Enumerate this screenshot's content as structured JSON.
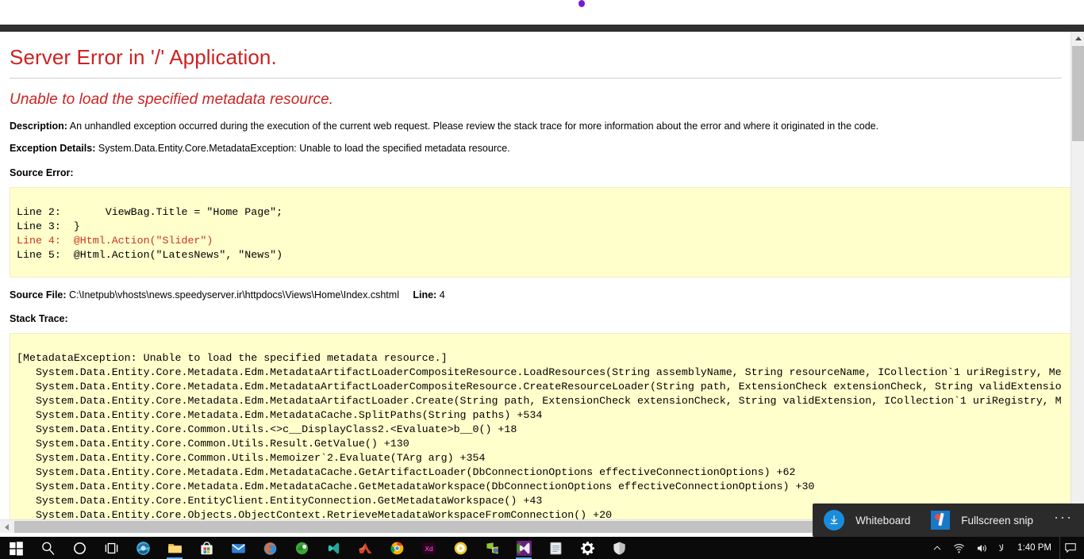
{
  "error_page": {
    "title": "Server Error in '/' Application.",
    "subtitle": "Unable to load the specified metadata resource.",
    "description_label": "Description:",
    "description_text": "An unhandled exception occurred during the execution of the current web request. Please review the stack trace for more information about the error and where it originated in the code.",
    "exception_label": "Exception Details:",
    "exception_text": "System.Data.Entity.Core.MetadataException: Unable to load the specified metadata resource.",
    "source_error_label": "Source Error:",
    "source_code_before": "Line 2:       ViewBag.Title = \"Home Page\";\nLine 3:  }\n",
    "source_code_highlight": "Line 4:  @Html.Action(\"Slider\")",
    "source_code_after": "\nLine 5:  @Html.Action(\"LatesNews\", \"News\")",
    "source_file_label": "Source File:",
    "source_file_path": "C:\\Inetpub\\vhosts\\news.speedyserver.ir\\httpdocs\\Views\\Home\\Index.cshtml",
    "line_label": "Line:",
    "line_number": "4",
    "stack_trace_label": "Stack Trace:",
    "stack_trace": "[MetadataException: Unable to load the specified metadata resource.]\n   System.Data.Entity.Core.Metadata.Edm.MetadataArtifactLoaderCompositeResource.LoadResources(String assemblyName, String resourceName, ICollection`1 uriRegistry, Me\n   System.Data.Entity.Core.Metadata.Edm.MetadataArtifactLoaderCompositeResource.CreateResourceLoader(String path, ExtensionCheck extensionCheck, String validExtensio\n   System.Data.Entity.Core.Metadata.Edm.MetadataArtifactLoader.Create(String path, ExtensionCheck extensionCheck, String validExtension, ICollection`1 uriRegistry, M\n   System.Data.Entity.Core.Metadata.Edm.MetadataCache.SplitPaths(String paths) +534\n   System.Data.Entity.Core.Common.Utils.<>c__DisplayClass2.<Evaluate>b__0() +18\n   System.Data.Entity.Core.Common.Utils.Result.GetValue() +130\n   System.Data.Entity.Core.Common.Utils.Memoizer`2.Evaluate(TArg arg) +354\n   System.Data.Entity.Core.Metadata.Edm.MetadataCache.GetArtifactLoader(DbConnectionOptions effectiveConnectionOptions) +62\n   System.Data.Entity.Core.Metadata.Edm.MetadataCache.GetMetadataWorkspace(DbConnectionOptions effectiveConnectionOptions) +30\n   System.Data.Entity.Core.EntityClient.EntityConnection.GetMetadataWorkspace() +43\n   System.Data.Entity.Core.Objects.ObjectContext.RetrieveMetadataWorkspaceFromConnection() +20\n   System.Data.Entity.Core.Objects.ObjectContext..ctor(EntityConnection connection, Boolean isConnectionConstructor, Objec",
    "colors": {
      "title_red": "#cc2222",
      "code_background": "#ffffcc",
      "highlight_red": "#cc3322"
    }
  },
  "snip_toolbar": {
    "whiteboard_label": "Whiteboard",
    "whiteboard_icon": "download-circle-icon",
    "fullscreen_snip_label": "Fullscreen snip",
    "fullscreen_snip_icon": "snip-pen-icon",
    "more_label": "···"
  },
  "taskbar": {
    "items": [
      {
        "icon": "windows-start-icon",
        "name": "start-button"
      },
      {
        "icon": "search-icon",
        "name": "search-button"
      },
      {
        "icon": "cortana-circle-icon",
        "name": "cortana-button"
      },
      {
        "icon": "task-view-icon",
        "name": "task-view-button"
      },
      {
        "icon": "microsoft-edge-icon",
        "name": "taskbar-edge"
      },
      {
        "icon": "file-explorer-icon",
        "name": "taskbar-file-explorer"
      },
      {
        "icon": "microsoft-store-icon",
        "name": "taskbar-store"
      },
      {
        "icon": "mail-icon",
        "name": "taskbar-mail"
      },
      {
        "icon": "firefox-icon",
        "name": "taskbar-firefox"
      },
      {
        "icon": "navicat-icon",
        "name": "taskbar-navicat"
      },
      {
        "icon": "vs-code-icon",
        "name": "taskbar-vscode"
      },
      {
        "icon": "matlab-icon",
        "name": "taskbar-matlab"
      },
      {
        "icon": "google-chrome-icon",
        "name": "taskbar-chrome"
      },
      {
        "icon": "adobe-xd-icon",
        "name": "taskbar-adobe-xd"
      },
      {
        "icon": "media-player-icon",
        "name": "taskbar-media-player"
      },
      {
        "icon": "sql-server-icon",
        "name": "taskbar-sql-server"
      },
      {
        "icon": "visual-studio-icon",
        "name": "taskbar-visual-studio"
      },
      {
        "icon": "notepad-icon",
        "name": "taskbar-notepad"
      },
      {
        "icon": "settings-gear-icon",
        "name": "taskbar-settings"
      },
      {
        "icon": "shield-icon",
        "name": "taskbar-security"
      }
    ],
    "tray": {
      "chevron": "chevron-up-icon",
      "network": "wifi-icon",
      "volume": "speaker-icon",
      "language": "لا",
      "clock": "1:40 PM",
      "action_center": "notification-icon"
    }
  }
}
